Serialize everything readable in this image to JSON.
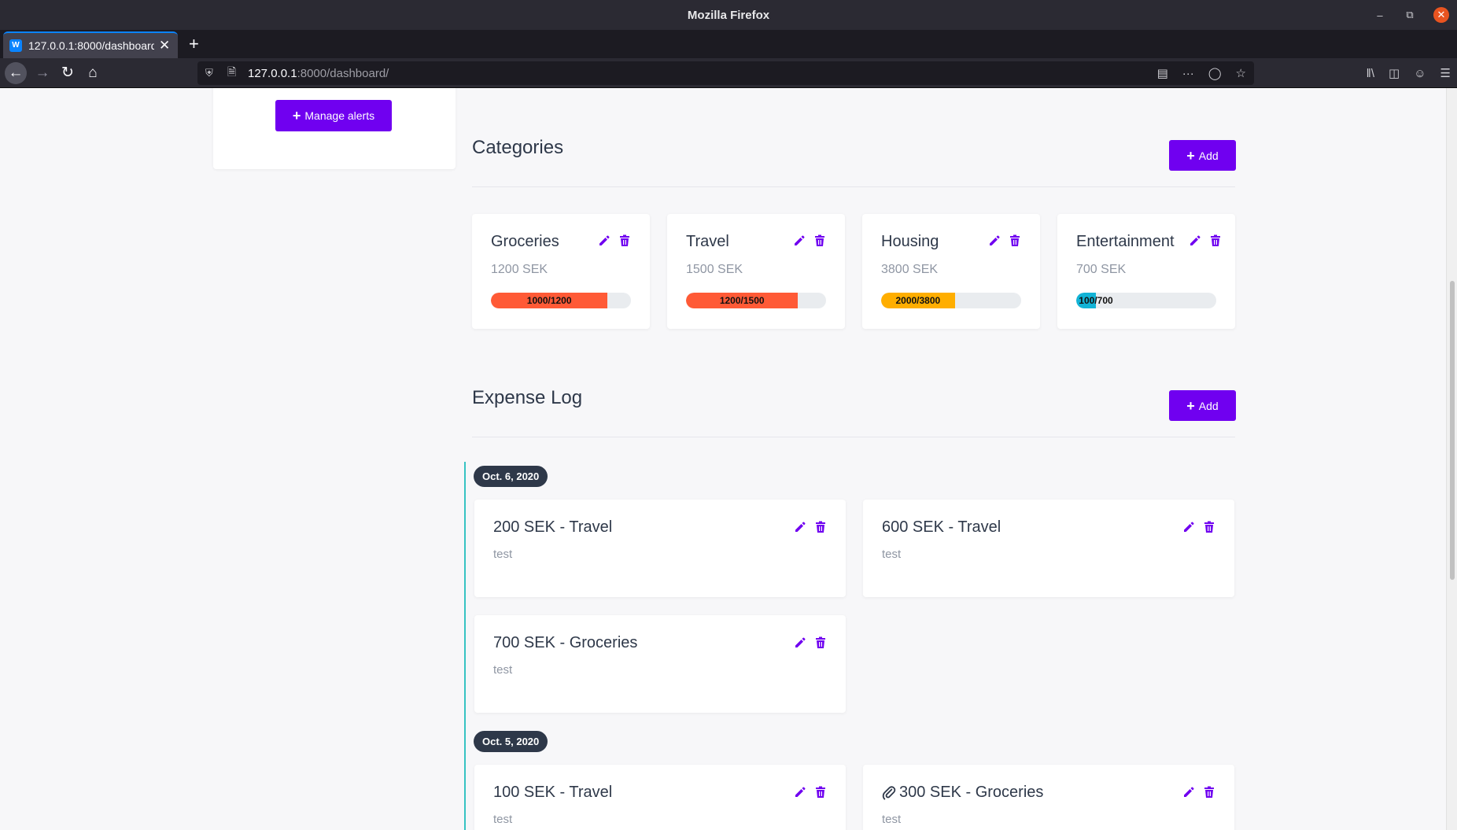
{
  "browser": {
    "window_title": "Mozilla Firefox",
    "tab_title": "127.0.0.1:8000/dashboard/",
    "favicon_letter": "W",
    "url_host": "127.0.0.1",
    "url_rest": ":8000/dashboard/"
  },
  "alerts": {
    "manage_label": "Manage alerts"
  },
  "categories": {
    "heading": "Categories",
    "add_label": "Add",
    "items": [
      {
        "name": "Groceries",
        "amount": "1200 SEK",
        "progress_label": "1000/1200",
        "spent": 1000,
        "budget": 1200,
        "color": "#ff5a36"
      },
      {
        "name": "Travel",
        "amount": "1500 SEK",
        "progress_label": "1200/1500",
        "spent": 1200,
        "budget": 1500,
        "color": "#ff5a36"
      },
      {
        "name": "Housing",
        "amount": "3800 SEK",
        "progress_label": "2000/3800",
        "spent": 2000,
        "budget": 3800,
        "color": "#ffae00"
      },
      {
        "name": "Entertainment",
        "amount": "700 SEK",
        "progress_label": "100/700",
        "spent": 100,
        "budget": 700,
        "color": "#12b3d6"
      }
    ]
  },
  "expenses": {
    "heading": "Expense Log",
    "add_label": "Add",
    "groups": [
      {
        "date": "Oct. 6, 2020",
        "items": [
          {
            "title": "200 SEK - Travel",
            "desc": "test",
            "attachment": false
          },
          {
            "title": "600 SEK - Travel",
            "desc": "test",
            "attachment": false
          },
          {
            "title": "700 SEK - Groceries",
            "desc": "test",
            "attachment": false
          }
        ]
      },
      {
        "date": "Oct. 5, 2020",
        "items": [
          {
            "title": "100 SEK - Travel",
            "desc": "test",
            "attachment": false
          },
          {
            "title": "300 SEK - Groceries",
            "desc": "test",
            "attachment": true
          }
        ]
      }
    ]
  },
  "colors": {
    "accent": "#7000f0",
    "timeline": "#37c3c3",
    "badge": "#2e3849"
  }
}
